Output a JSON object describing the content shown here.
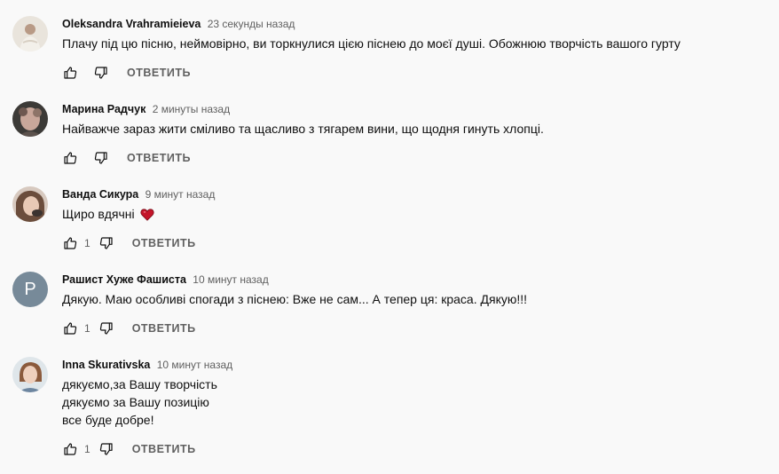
{
  "reply_label": "ОТВЕТИТЬ",
  "icons": {
    "like": "thumb-up-icon",
    "dislike": "thumb-down-icon",
    "heart": "heart-emoji"
  },
  "colors": {
    "background": "#f9f9f9",
    "meta_text": "#606060",
    "heart": "#c4152a",
    "letter_avatar": "#778a99"
  },
  "comments": [
    {
      "author": "Oleksandra Vrahramieieva",
      "time": "23 секунды назад",
      "lines": [
        "Плачу під цю пісню, неймовірно, ви торкнулися цією піснею до моєї душі. Обожнюю творчість вашого гурту"
      ],
      "likes": ""
    },
    {
      "author": "Марина Радчук",
      "time": "2 минуты назад",
      "lines": [
        "Найважче зараз жити сміливо та щасливо з тягарем вини, що щодня гинуть хлопці."
      ],
      "likes": ""
    },
    {
      "author": "Ванда Сикура",
      "time": "9 минут назад",
      "lines": [
        "Щиро вдячні"
      ],
      "likes": "1"
    },
    {
      "author": "Рашист Хуже Фашиста",
      "time": "10 минут назад",
      "avatar_letter": "P",
      "lines": [
        "Дякую. Маю особливі спогади з піснею: Вже не сам... А тепер ця: краса. Дякую!!!"
      ],
      "likes": "1"
    },
    {
      "author": "Inna Skurativska",
      "time": "10 минут назад",
      "lines": [
        "дякуємо,за Вашу творчість",
        "дякуємо за Вашу позицію",
        "все буде добре!"
      ],
      "likes": "1"
    }
  ]
}
